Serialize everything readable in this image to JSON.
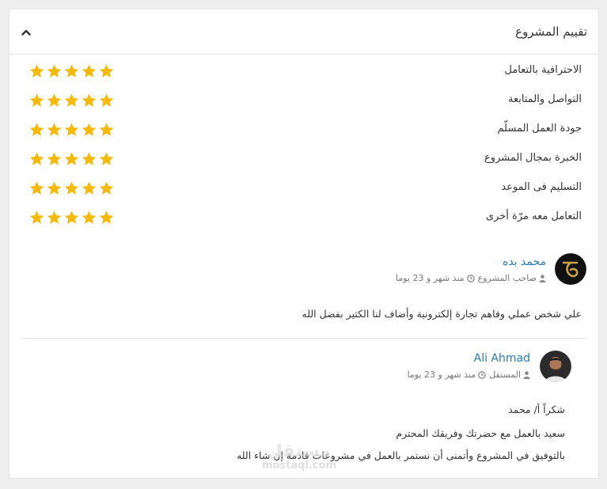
{
  "panel": {
    "title": "تقييم المشروع",
    "collapse_icon": "chevron-up-icon"
  },
  "ratings": [
    {
      "label": "الاحترافية بالتعامل",
      "stars": 5
    },
    {
      "label": "التواصل والمتابعة",
      "stars": 5
    },
    {
      "label": "جودة العمل المسلّم",
      "stars": 5
    },
    {
      "label": "الخبرة بمجال المشروع",
      "stars": 5
    },
    {
      "label": "التسليم فى الموعد",
      "stars": 5
    },
    {
      "label": "التعامل معه مرّة أخرى",
      "stars": 5
    }
  ],
  "colors": {
    "star": "#f5b90a",
    "link": "#2a7ab0",
    "muted": "#777777"
  },
  "reviews": [
    {
      "name": "محمد بده",
      "role": "صاحب المشروع",
      "role_icon": "user-icon",
      "time": "منذ شهر و 23 يوما",
      "time_icon": "clock-icon",
      "lines": [
        "علي شخص عملي وفاهم تجارة إلكترونية وأضاف لنا الكثير بفضل الله"
      ]
    },
    {
      "name": "Ali Ahmad",
      "role": "المستقل",
      "role_icon": "user-icon",
      "time": "منذ شهر و 23 يوما",
      "time_icon": "clock-icon",
      "lines": [
        "شكراً أ/ محمد",
        "سعيد بالعمل مع حضرتك وفريقك المحترم",
        "بالتوفيق في المشروع وأتمنى أن نستمر بالعمل في مشروعات قادمة إن شاء الله"
      ]
    }
  ],
  "watermark": {
    "logo": "مستقل",
    "url": "mostaql.com"
  }
}
